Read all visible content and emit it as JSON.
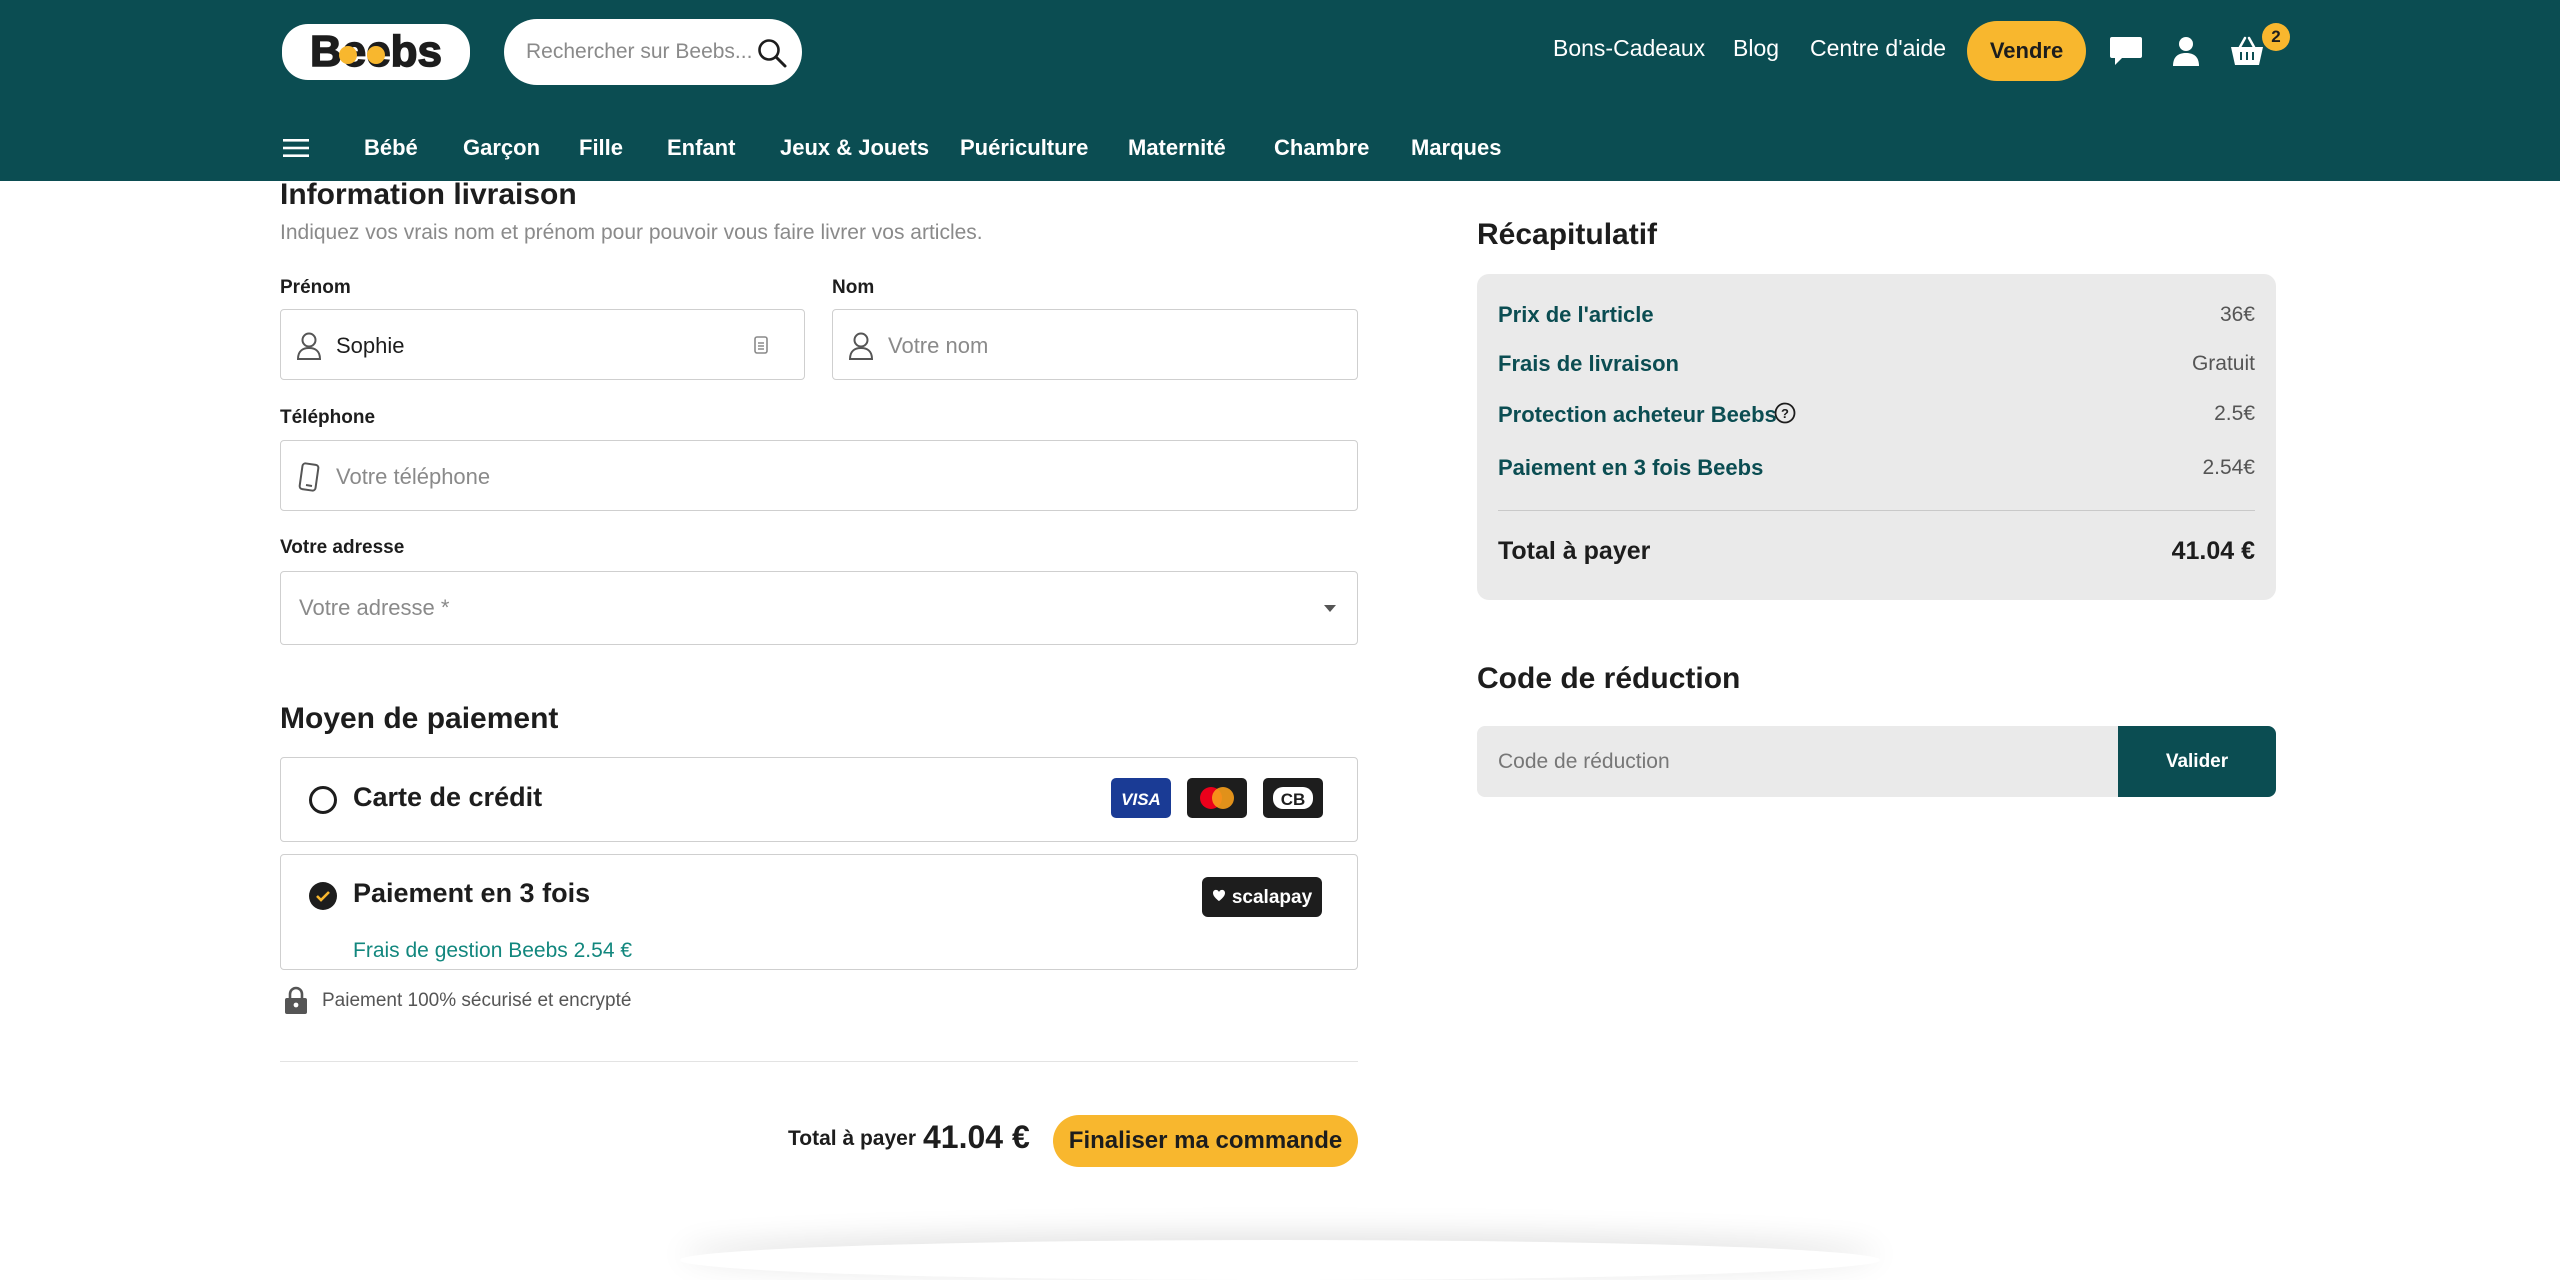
{
  "header": {
    "logo_text": "Beebs",
    "search_placeholder": "Rechercher sur Beebs...",
    "links": [
      "Bons-Cadeaux",
      "Blog",
      "Centre d'aide"
    ],
    "sell_label": "Vendre",
    "cart_count": "2",
    "icons": [
      "chat-icon",
      "user-icon",
      "basket-icon"
    ]
  },
  "categories": [
    "Bébé",
    "Garçon",
    "Fille",
    "Enfant",
    "Jeux & Jouets",
    "Puériculture",
    "Maternité",
    "Chambre",
    "Marques"
  ],
  "shipping": {
    "title": "Information livraison",
    "subtitle": "Indiquez vos vrais nom et prénom pour pouvoir vous faire livrer vos articles.",
    "first_name_label": "Prénom",
    "first_name_value": "Sophie",
    "last_name_label": "Nom",
    "last_name_placeholder": "Votre nom",
    "phone_label": "Téléphone",
    "phone_placeholder": "Votre téléphone",
    "address_label": "Votre adresse",
    "address_placeholder": "Votre adresse *"
  },
  "payment": {
    "title": "Moyen de paiement",
    "options": [
      {
        "label": "Carte de crédit",
        "selected": false,
        "logos": [
          "VISA",
          "mastercard",
          "CB"
        ]
      },
      {
        "label": "Paiement en 3 fois",
        "selected": true,
        "fee_text": "Frais de gestion Beebs 2.54 €",
        "logo": "scalapay"
      }
    ],
    "secure_text": "Paiement 100% sécurisé et encrypté"
  },
  "checkout_bar": {
    "total_label": "Total à payer",
    "total_value": "41.04 €",
    "finalize_label": "Finaliser ma commande"
  },
  "summary": {
    "title": "Récapitulatif",
    "rows": [
      {
        "label": "Prix de l'article",
        "value": "36€"
      },
      {
        "label": "Frais de livraison",
        "value": "Gratuit"
      },
      {
        "label": "Protection acheteur Beebs",
        "value": "2.5€"
      },
      {
        "label": "Paiement en 3 fois Beebs",
        "value": "2.54€"
      }
    ],
    "total_label": "Total à payer",
    "total_value": "41.04 €"
  },
  "discount": {
    "title": "Code de réduction",
    "placeholder": "Code de réduction",
    "validate_label": "Valider"
  },
  "colors": {
    "header_bg": "#0b4d52",
    "accent_yellow": "#f8b72e",
    "teal_text": "#0b4d52",
    "fee_green": "#12877e"
  }
}
